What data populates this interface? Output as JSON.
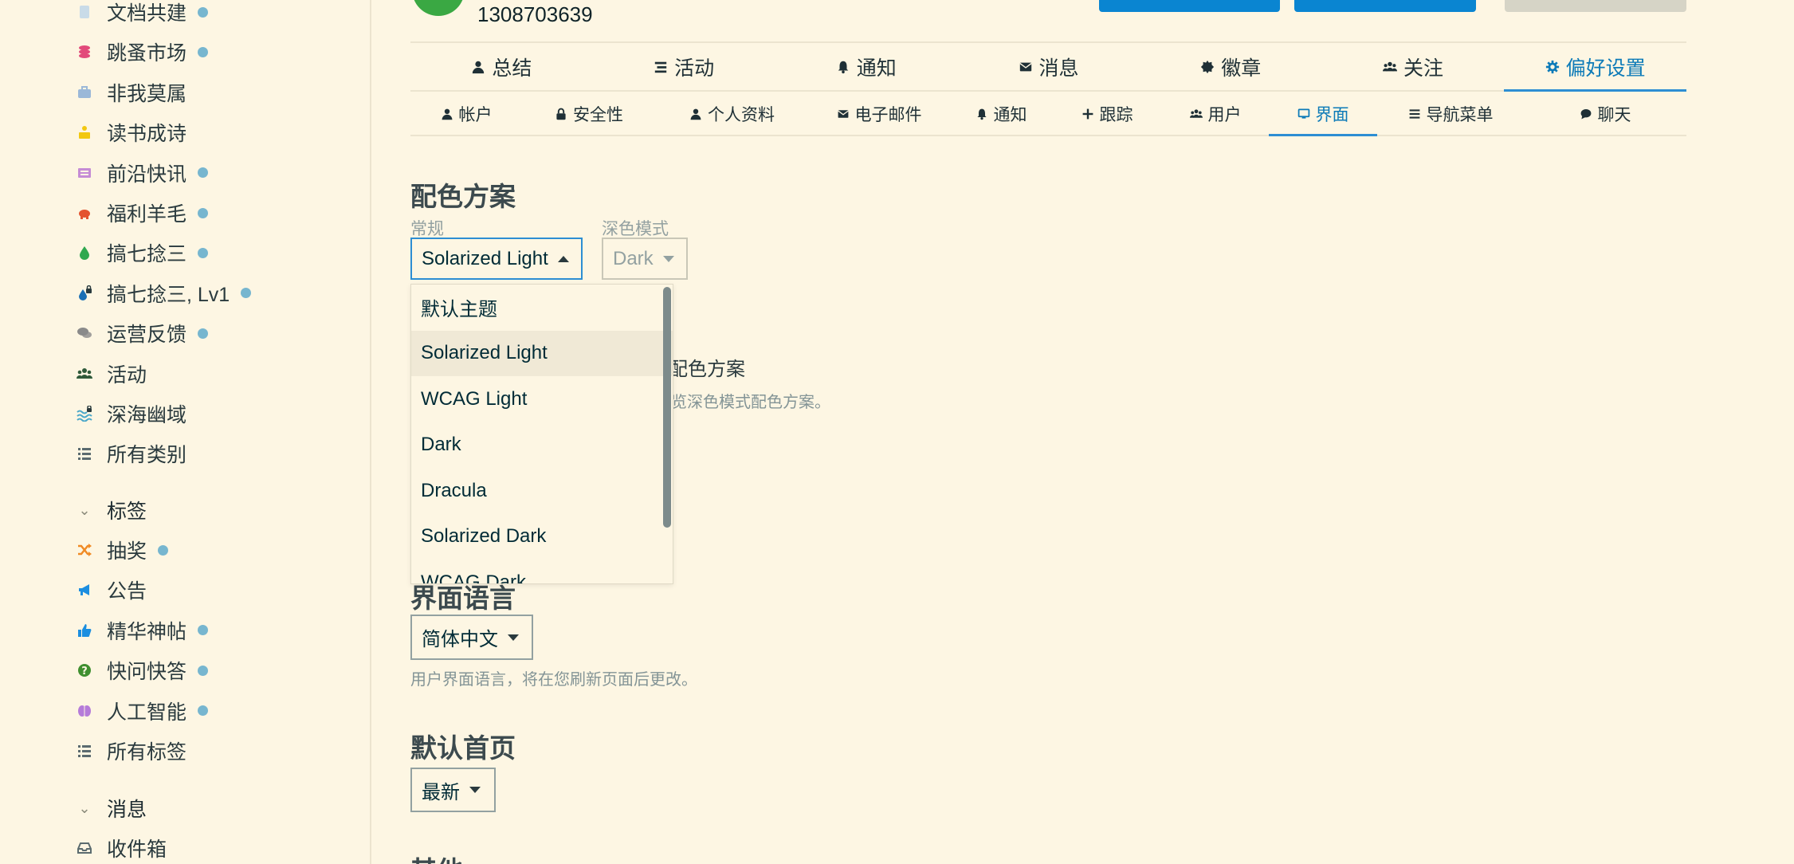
{
  "sidebar": {
    "categories": [
      {
        "label": "文档共建",
        "icon": "document-icon",
        "color": "#c9dbe8",
        "dot": true
      },
      {
        "label": "跳蚤市场",
        "icon": "coins-icon",
        "color": "#e24a7a",
        "dot": true
      },
      {
        "label": "非我莫属",
        "icon": "briefcase-icon",
        "color": "#9bb8d8",
        "dot": false
      },
      {
        "label": "读书成诗",
        "icon": "book-reader-icon",
        "color": "#f2c811",
        "dot": false
      },
      {
        "label": "前沿快讯",
        "icon": "newspaper-icon",
        "color": "#c58bd5",
        "dot": true
      },
      {
        "label": "福利羊毛",
        "icon": "piggy-bank-icon",
        "color": "#e4532f",
        "dot": true
      },
      {
        "label": "搞七捻三",
        "icon": "droplet-icon",
        "color": "#2fa84f",
        "dot": true
      },
      {
        "label": "搞七捻三, Lv1",
        "icon": "locked-droplet-icon",
        "color": "#1a6fb5",
        "dot": true
      },
      {
        "label": "运营反馈",
        "icon": "comments-icon",
        "color": "#8a8a8a",
        "dot": true
      },
      {
        "label": "活动",
        "icon": "users-icon",
        "color": "#2f5a3a",
        "dot": false
      },
      {
        "label": "深海幽域",
        "icon": "water-lock-icon",
        "color": "#4aa7c9",
        "dot": false
      },
      {
        "label": "所有类别",
        "icon": "list-icon",
        "color": "#5b6b6f",
        "dot": false
      }
    ],
    "tags_header": "标签",
    "tags": [
      {
        "label": "抽奖",
        "icon": "shuffle-icon",
        "color": "#f08a24",
        "dot": true
      },
      {
        "label": "公告",
        "icon": "bullhorn-icon",
        "color": "#1b8ee0",
        "dot": false
      },
      {
        "label": "精华神帖",
        "icon": "thumbs-up-icon",
        "color": "#1b8ee0",
        "dot": true
      },
      {
        "label": "快问快答",
        "icon": "question-circle-icon",
        "color": "#3f8f2f",
        "dot": true
      },
      {
        "label": "人工智能",
        "icon": "brain-icon",
        "color": "#b57bd9",
        "dot": true
      },
      {
        "label": "所有标签",
        "icon": "list-icon",
        "color": "#5b6b6f",
        "dot": false
      }
    ],
    "messages_header": "消息",
    "messages": [
      {
        "label": "收件箱",
        "icon": "inbox-icon",
        "color": "#5b6b6f",
        "dot": false
      }
    ]
  },
  "header": {
    "user_id": "1308703639"
  },
  "nav_primary": [
    {
      "label": "总结",
      "icon": "user-icon",
      "active": false
    },
    {
      "label": "活动",
      "icon": "stream-icon",
      "active": false
    },
    {
      "label": "通知",
      "icon": "bell-icon",
      "active": false
    },
    {
      "label": "消息",
      "icon": "envelope-icon",
      "active": false
    },
    {
      "label": "徽章",
      "icon": "certificate-icon",
      "active": false
    },
    {
      "label": "关注",
      "icon": "users-icon",
      "active": false
    },
    {
      "label": "偏好设置",
      "icon": "gear-icon",
      "active": true
    }
  ],
  "nav_secondary": [
    {
      "label": "帐户",
      "icon": "user-icon",
      "active": false
    },
    {
      "label": "安全性",
      "icon": "lock-icon",
      "active": false
    },
    {
      "label": "个人资料",
      "icon": "user-icon",
      "active": false
    },
    {
      "label": "电子邮件",
      "icon": "envelope-icon",
      "active": false
    },
    {
      "label": "通知",
      "icon": "bell-icon",
      "active": false
    },
    {
      "label": "跟踪",
      "icon": "plus-icon",
      "active": false
    },
    {
      "label": "用户",
      "icon": "users-icon",
      "active": false
    },
    {
      "label": "界面",
      "icon": "desktop-icon",
      "active": true
    },
    {
      "label": "导航菜单",
      "icon": "bars-icon",
      "active": false
    },
    {
      "label": "聊天",
      "icon": "comment-icon",
      "active": false
    }
  ],
  "color_scheme": {
    "title": "配色方案",
    "regular_label": "常规",
    "regular_value": "Solarized Light",
    "dark_label": "深色模式",
    "dark_value": "Dark",
    "options": [
      "默认主题",
      "Solarized Light",
      "WCAG Light",
      "Dark",
      "Dracula",
      "Solarized Dark",
      "WCAG Dark"
    ],
    "selected_option": "Solarized Light",
    "hidden_checkbox_text": "配色方案",
    "hidden_help_text": "览深色模式配色方案。"
  },
  "language": {
    "title": "界面语言",
    "value": "简体中文",
    "help": "用户界面语言，将在您刷新页面后更改。"
  },
  "homepage": {
    "title": "默认首页",
    "value": "最新"
  },
  "other": {
    "title": "其他"
  },
  "colors": {
    "background": "#fdf6e3",
    "accent": "#2d8ed3",
    "header_button": "#0a85d1"
  }
}
